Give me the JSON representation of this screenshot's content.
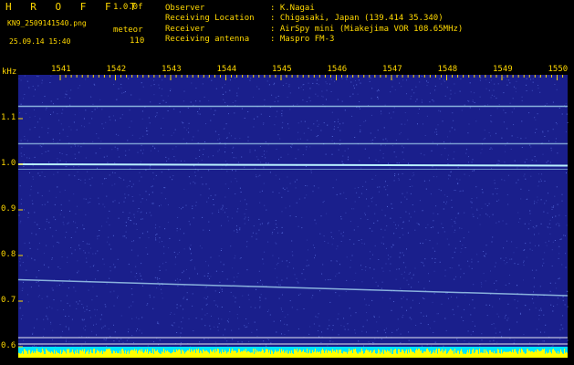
{
  "header": {
    "app_title": "H R O F F T",
    "version": "1.0.0f",
    "filename": "KN9_2509141540.png",
    "meteor_label": "meteor",
    "datetime": "25.09.14 15:40",
    "meteor_count": "110",
    "observer_label": "Observer",
    "observer_value": ": K.Nagai",
    "location_label": "Receiving Location",
    "location_value": ": Chigasaki, Japan (139.414 35.340)",
    "receiver_label": "Receiver",
    "receiver_value": ": AirSpy mini (Miakejima VOR 108.65MHz)",
    "antenna_label": "Receiving antenna",
    "antenna_value": ": Maspro FM-3"
  },
  "plot": {
    "unit": "kHz",
    "x_ticks": [
      "1541",
      "1542",
      "1543",
      "1544",
      "1545",
      "1546",
      "1547",
      "1548",
      "1549",
      "1550"
    ],
    "y_ticks": [
      "1.1",
      "1.0",
      "0.9",
      "0.8",
      "0.7",
      "0.6"
    ],
    "colors": {
      "background": "#1a1f8c",
      "noise": "#5a70e0",
      "signal": "#b8f0ff",
      "axis_text": "#ffd800",
      "bottom_bar_cyan": "#00e5ff",
      "bottom_bar_yellow": "#ffff00"
    }
  }
}
